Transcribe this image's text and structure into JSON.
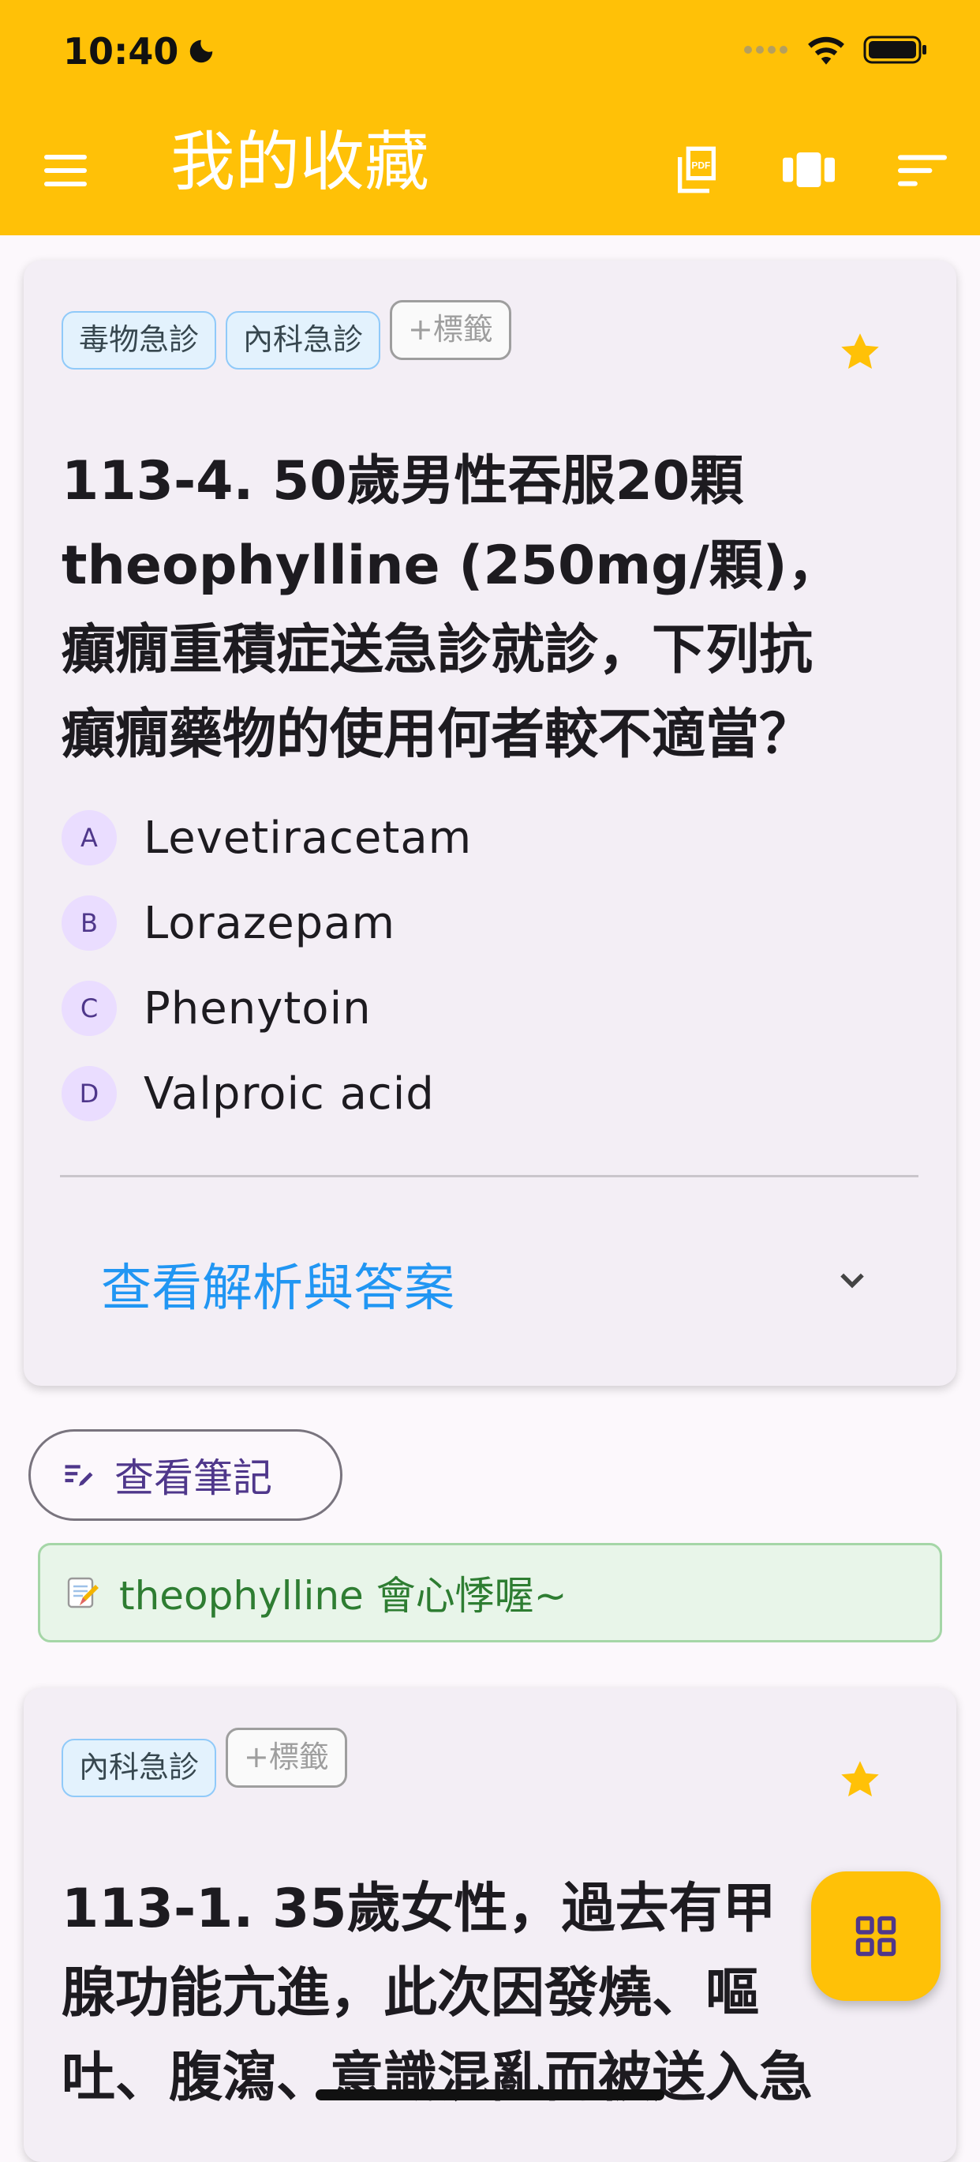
{
  "status": {
    "time": "10:40"
  },
  "appbar": {
    "title": "我的收藏"
  },
  "cards": [
    {
      "tags": [
        "毒物急診",
        "內科急診"
      ],
      "add_tag": "+標籤",
      "question_lines": [
        "113-4. 50歲男性吞服20顆",
        "theophylline (250mg/顆)，",
        "癲癇重積症送急診就診，下列抗",
        "癲癇藥物的使用何者較不適當？"
      ],
      "options": [
        {
          "letter": "A",
          "text": "Levetiracetam"
        },
        {
          "letter": "B",
          "text": "Lorazepam"
        },
        {
          "letter": "C",
          "text": "Phenytoin"
        },
        {
          "letter": "D",
          "text": "Valproic acid"
        }
      ],
      "reveal_label": "查看解析與答案"
    },
    {
      "tags": [
        "內科急診"
      ],
      "add_tag": "+標籤",
      "question_lines": [
        "113-1. 35歲女性，過去有甲",
        "腺功能亢進，此次因發燒、嘔",
        "吐、腹瀉、意識混亂而被送入急"
      ]
    }
  ],
  "note": {
    "button_label": "查看筆記",
    "text": "theophylline 會心悸喔~"
  },
  "colors": {
    "primary": "#ffc107",
    "link": "#2196f3",
    "note_green": "#2e7d32"
  }
}
